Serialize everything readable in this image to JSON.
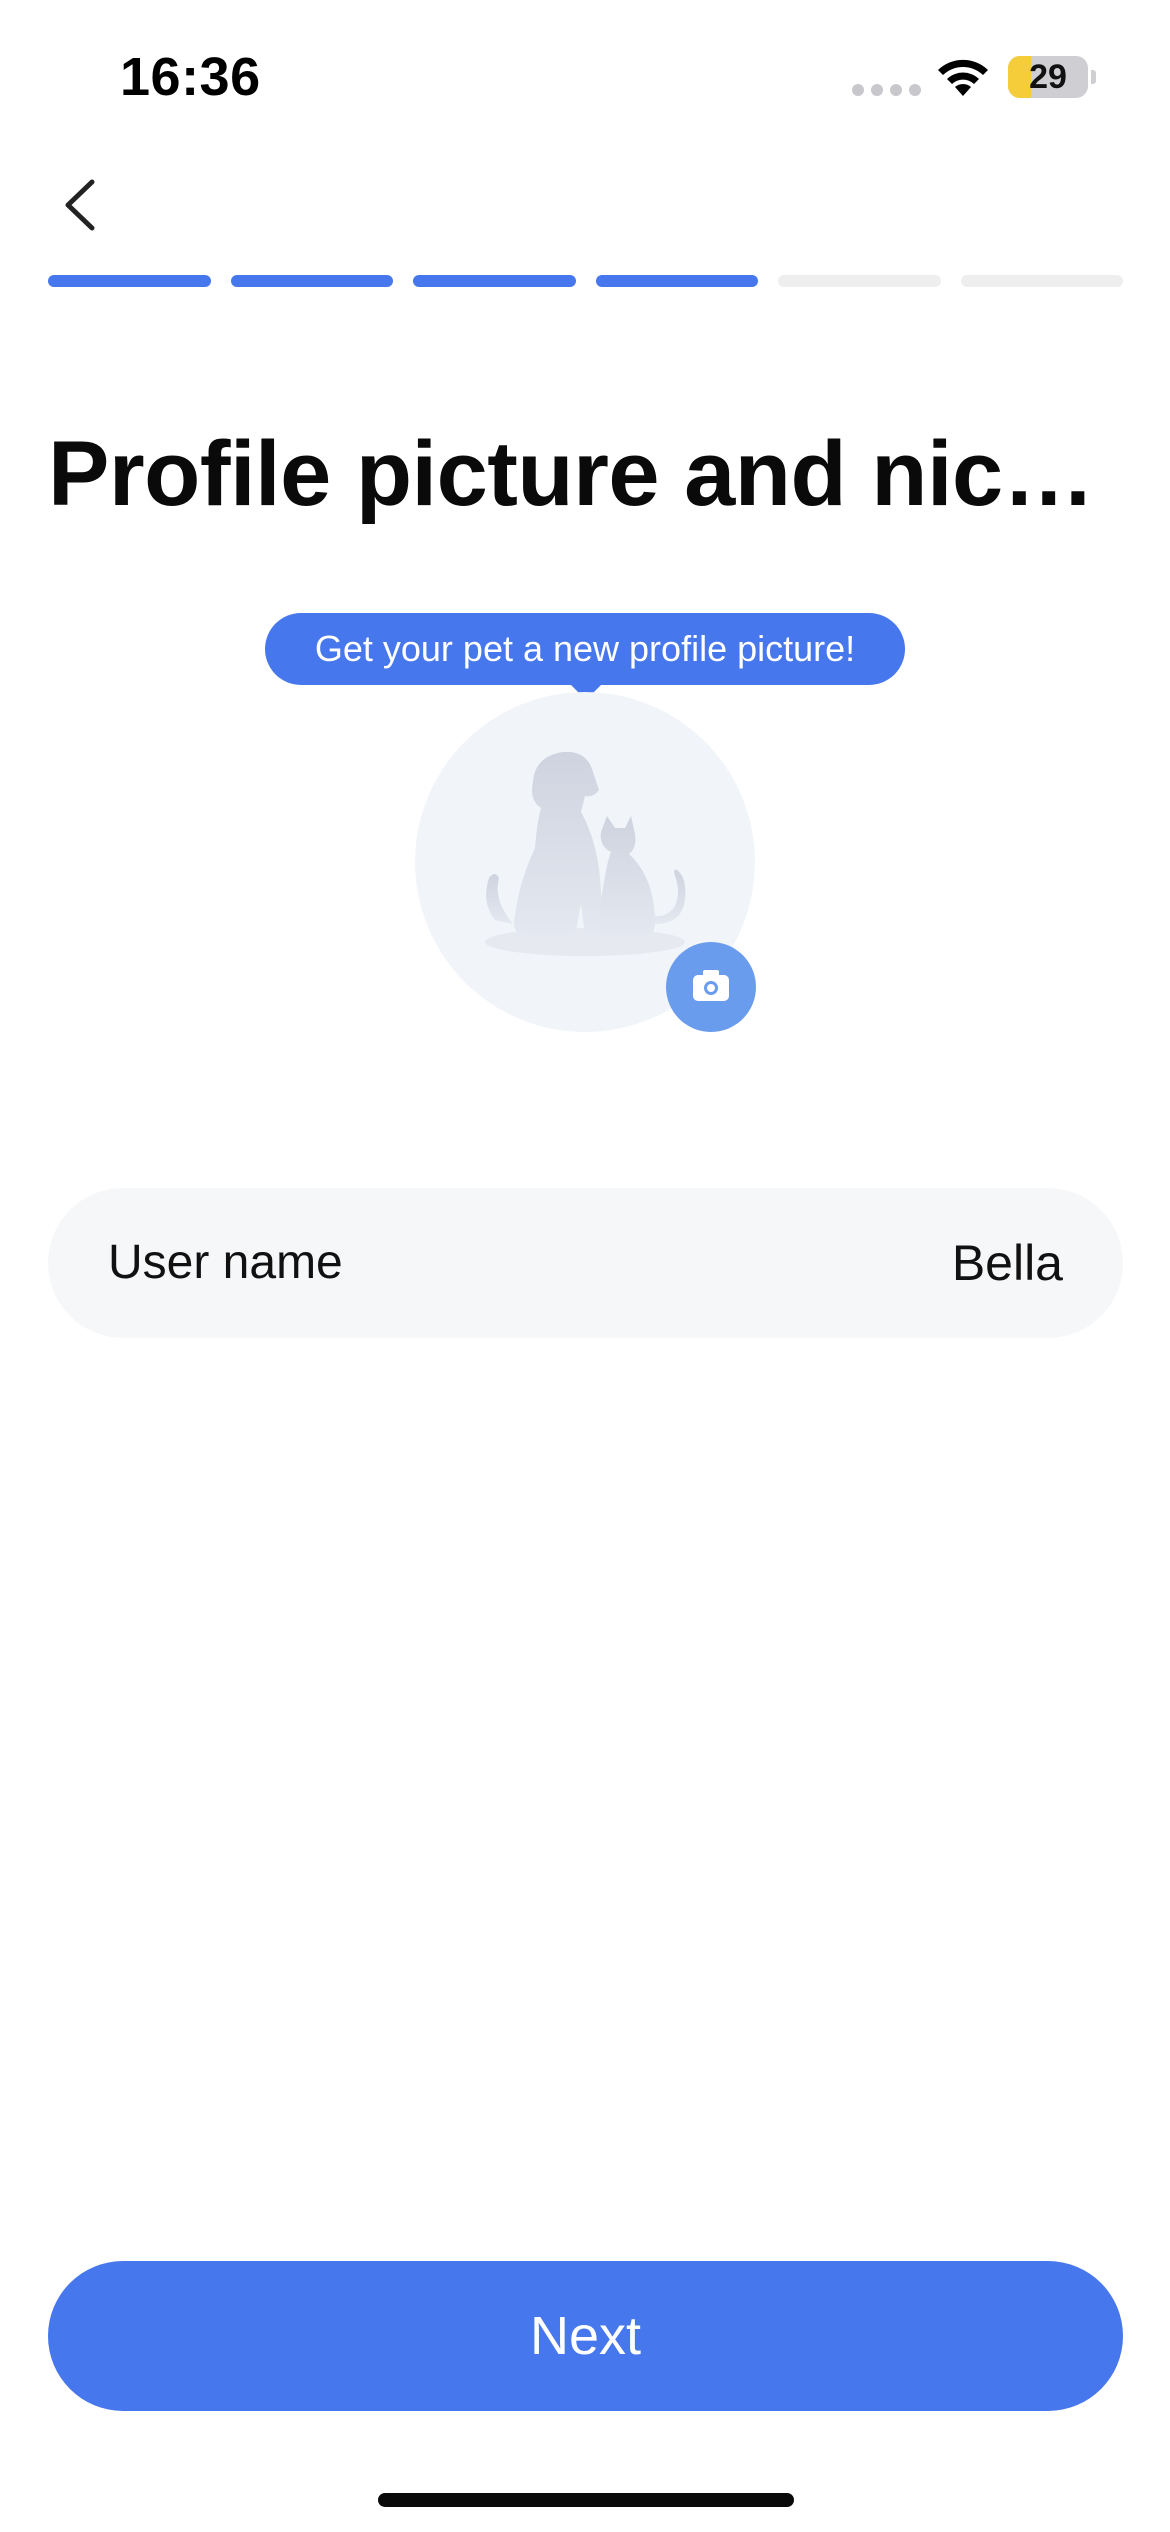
{
  "status_bar": {
    "time": "16:36",
    "battery_level": "29",
    "battery_fraction": 0.29,
    "icons": [
      "cellular-signal-icon",
      "wifi-icon",
      "battery-icon"
    ]
  },
  "nav": {
    "back_icon": "chevron-left-icon",
    "progress": {
      "total_steps": 6,
      "completed_steps": 4
    }
  },
  "page": {
    "title": "Profile picture and nickn…"
  },
  "avatar": {
    "tooltip": "Get your pet a new profile picture!",
    "placeholder_icon": "dog-and-cat-silhouette-icon",
    "camera_icon": "camera-icon"
  },
  "form": {
    "username_label": "User name",
    "username_value": "Bella"
  },
  "actions": {
    "next_label": "Next"
  },
  "colors": {
    "accent": "#4677ec",
    "progress_inactive": "#eeeeee",
    "field_background": "#f6f7f9",
    "avatar_background": "#f1f4f9",
    "camera_button": "#6a9cee"
  }
}
